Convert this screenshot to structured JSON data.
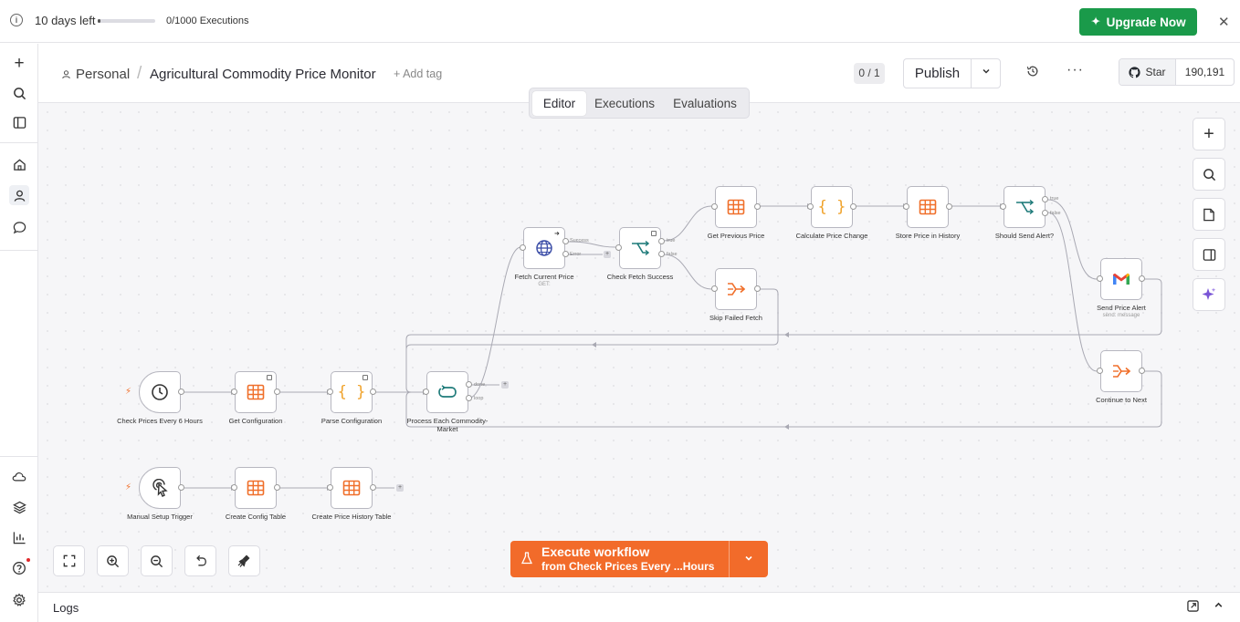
{
  "banner": {
    "days_left": "10 days left",
    "executions_used": 0,
    "executions_limit": 1000,
    "executions_text": "0/1000 Executions",
    "upgrade_label": "Upgrade Now",
    "upgrade_color": "#1a9a4a"
  },
  "header": {
    "project": "Personal",
    "workflow_title": "Agricultural Commodity Price Monitor",
    "add_tag": "+ Add tag",
    "counter": "0 / 1",
    "publish_label": "Publish",
    "github_star": "Star",
    "github_count": "190,191"
  },
  "tabs": [
    {
      "label": "Editor",
      "active": true
    },
    {
      "label": "Executions",
      "active": false
    },
    {
      "label": "Evaluations",
      "active": false
    }
  ],
  "nodes": {
    "check_prices": {
      "label": "Check Prices Every 6 Hours",
      "icon": "clock-icon"
    },
    "get_config": {
      "label": "Get Configuration",
      "icon": "table-icon"
    },
    "parse_config": {
      "label": "Parse Configuration",
      "icon": "code-braces-icon"
    },
    "process_each": {
      "label": "Process Each Commodity-Market",
      "icon": "loop-icon",
      "out_done": "done",
      "out_loop": "loop"
    },
    "fetch_price": {
      "label": "Fetch Current Price",
      "sub": "GET:",
      "icon": "globe-icon",
      "out_success": "Success",
      "out_error": "Error"
    },
    "check_fetch": {
      "label": "Check Fetch Success",
      "icon": "if-branch-icon",
      "out_true": "true",
      "out_false": "false"
    },
    "get_previous": {
      "label": "Get Previous Price",
      "icon": "table-icon"
    },
    "skip_failed": {
      "label": "Skip Failed Fetch",
      "icon": "noop-icon"
    },
    "calc_change": {
      "label": "Calculate Price Change",
      "icon": "code-braces-icon"
    },
    "store_history": {
      "label": "Store Price in History",
      "icon": "table-icon"
    },
    "should_alert": {
      "label": "Should Send Alert?",
      "icon": "if-branch-icon",
      "out_true": "true",
      "out_false": "false"
    },
    "send_alert": {
      "label": "Send Price Alert",
      "sub": "send: message",
      "icon": "gmail-icon"
    },
    "continue_next": {
      "label": "Continue to Next",
      "icon": "noop-icon"
    },
    "manual_trigger": {
      "label": "Manual Setup Trigger",
      "icon": "cursor-click-icon"
    },
    "create_config": {
      "label": "Create Config Table",
      "icon": "table-icon"
    },
    "create_history": {
      "label": "Create Price History Table",
      "icon": "table-icon"
    }
  },
  "execute": {
    "title": "Execute workflow",
    "subtitle": "from Check Prices Every ...Hours",
    "color": "#f26b2a"
  },
  "logs": {
    "label": "Logs"
  },
  "colors": {
    "node_orange": "#f06f2a",
    "node_teal": "#1f7b7a",
    "node_blue": "#3d4fa8"
  }
}
